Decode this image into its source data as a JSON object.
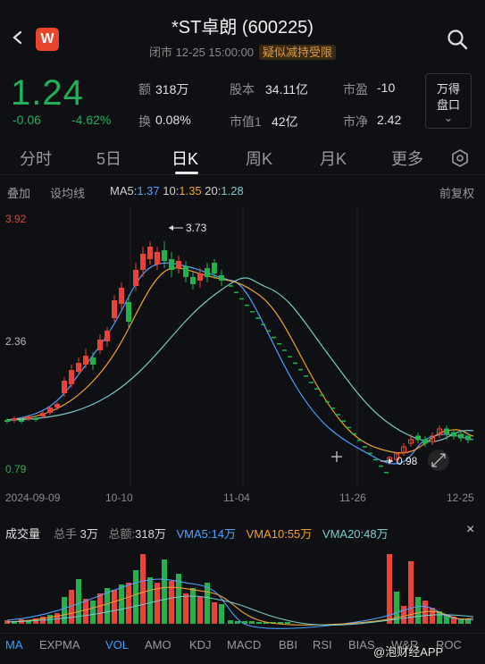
{
  "header": {
    "title": "*ST卓朗 (600225)",
    "status": "闭市 12-25 15:00:00",
    "warning_badge": "疑似减持受限",
    "logo_text": "W"
  },
  "quote": {
    "price": "1.24",
    "change": "-0.06",
    "change_pct": "-4.62%",
    "stats": [
      {
        "label": "额",
        "value": "318万"
      },
      {
        "label": "股本",
        "value": "34.11亿"
      },
      {
        "label": "市盈",
        "value": "-10"
      },
      {
        "label": "换",
        "value": "0.08%"
      },
      {
        "label": "市值1",
        "value": "42亿"
      },
      {
        "label": "市净",
        "value": "2.42"
      }
    ],
    "panel_line1": "万得",
    "panel_line2": "盘口",
    "panel_chevron": "⌄"
  },
  "tabs": [
    "分时",
    "5日",
    "日K",
    "周K",
    "月K",
    "更多"
  ],
  "active_tab": "日K",
  "toolbar": {
    "overlay": "叠加",
    "draw": "设均线",
    "ma5_label": "MA5:",
    "ma5_value": "1.37",
    "ma10_label": "10:",
    "ma10_value": "1.35",
    "ma20_label": "20:",
    "ma20_value": "1.28",
    "adjust": "前复权"
  },
  "chart": {
    "y_top": "3.92",
    "y_mid": "2.36",
    "y_bottom": "0.79",
    "high_annot": "3.73",
    "low_annot": "0.98",
    "dates": [
      "2024-09-09",
      "10-10",
      "11-04",
      "11-26",
      "12-25"
    ],
    "colors": {
      "up": "#e8423a",
      "down": "#22b14c",
      "ma5": "#4ea0ff",
      "ma10": "#f0a030",
      "ma20": "#79c9c9"
    }
  },
  "volume": {
    "title": "成交量",
    "total_hand_label": "总手",
    "total_hand_value": "3万",
    "total_amt_label": "总额",
    "total_amt_value": "318万",
    "vma5": "VMA5:14万",
    "vma10": "VMA10:55万",
    "vma20": "VMA20:48万",
    "close": "×"
  },
  "indicators": [
    "MA",
    "EXPMA",
    "VOL",
    "AMO",
    "KDJ",
    "MACD",
    "BBI",
    "RSI",
    "BIAS",
    "W&R",
    "ROC"
  ],
  "active_indicators": [
    "MA",
    "VOL"
  ],
  "watermark": "@泡财经APP"
}
